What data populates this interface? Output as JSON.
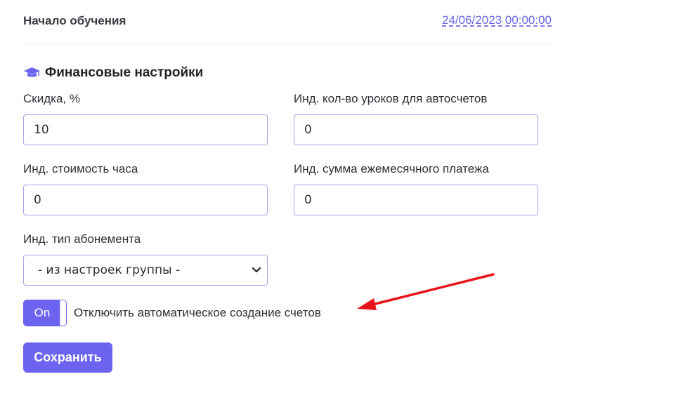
{
  "training_start": {
    "label": "Начало обучения",
    "value": "24/06/2023 00:00:00"
  },
  "finance_section": {
    "title": "Финансовые настройки",
    "icon": "graduation-cap-icon",
    "icon_color": "#6c63f0"
  },
  "fields": {
    "discount": {
      "label": "Скидка, %",
      "value": "10"
    },
    "auto_invoice_lessons": {
      "label": "Инд. кол-во уроков для автосчетов",
      "value": "0"
    },
    "hour_cost": {
      "label": "Инд. стоимость часа",
      "value": "0"
    },
    "monthly_payment": {
      "label": "Инд. сумма ежемесячного платежа",
      "value": "0"
    },
    "subscription_type": {
      "label": "Инд. тип абонемента",
      "selected": "- из настроек группы -"
    }
  },
  "disable_auto_invoices": {
    "state_label": "On",
    "label": "Отключить автоматическое создание счетов"
  },
  "save_label": "Сохранить",
  "colors": {
    "accent": "#6c63f0",
    "annotation_arrow": "#e8141b"
  }
}
